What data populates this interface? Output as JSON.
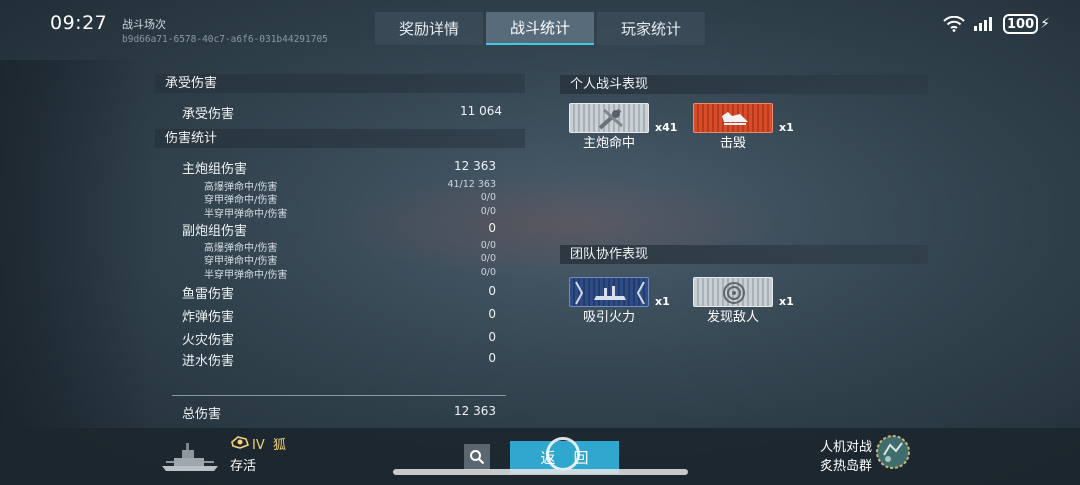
{
  "status_bar": {
    "time": "09:27",
    "battery": "100"
  },
  "header": {
    "title": "战斗场次",
    "battle_id": "b9d66a71-6578-40c7-a6f6-031b44291705"
  },
  "tabs": [
    {
      "label": "奖励详情",
      "active": false
    },
    {
      "label": "战斗统计",
      "active": true
    },
    {
      "label": "玩家统计",
      "active": false
    }
  ],
  "damage_taken": {
    "section": "承受伤害",
    "label": "承受伤害",
    "value": "11 064"
  },
  "damage_stats": {
    "section": "伤害统计",
    "main_battery": {
      "label": "主炮组伤害",
      "value": "12 363"
    },
    "main_sub": [
      {
        "label": "高爆弹命中/伤害",
        "value": "41/12 363"
      },
      {
        "label": "穿甲弹命中/伤害",
        "value": "0/0"
      },
      {
        "label": "半穿甲弹命中/伤害",
        "value": "0/0"
      }
    ],
    "secondary": {
      "label": "副炮组伤害",
      "value": "0"
    },
    "secondary_sub": [
      {
        "label": "高爆弹命中/伤害",
        "value": "0/0"
      },
      {
        "label": "穿甲弹命中/伤害",
        "value": "0/0"
      },
      {
        "label": "半穿甲弹命中/伤害",
        "value": "0/0"
      }
    ],
    "others": [
      {
        "label": "鱼雷伤害",
        "value": "0"
      },
      {
        "label": "炸弹伤害",
        "value": "0"
      },
      {
        "label": "火灾伤害",
        "value": "0"
      },
      {
        "label": "进水伤害",
        "value": "0"
      }
    ],
    "total": {
      "label": "总伤害",
      "value": "12 363"
    }
  },
  "personal": {
    "section": "个人战斗表现",
    "medals": [
      {
        "label": "主炮命中",
        "count": "x41",
        "icon": "main-battery-hit-icon",
        "color": "#c9cfd4"
      },
      {
        "label": "击毁",
        "count": "x1",
        "icon": "destroyed-icon",
        "color": "#d84c2a"
      }
    ]
  },
  "team": {
    "section": "团队协作表现",
    "medals": [
      {
        "label": "吸引火力",
        "count": "x1",
        "icon": "tank-damage-icon",
        "color": "#2e4d86"
      },
      {
        "label": "发现敌人",
        "count": "x1",
        "icon": "spotted-icon",
        "color": "#c9cfd4"
      }
    ]
  },
  "footer": {
    "ship_tier": "IV",
    "ship_name": "狐",
    "status": "存活",
    "back_label": "返回",
    "mode": "人机对战",
    "map": "炙热岛群"
  }
}
